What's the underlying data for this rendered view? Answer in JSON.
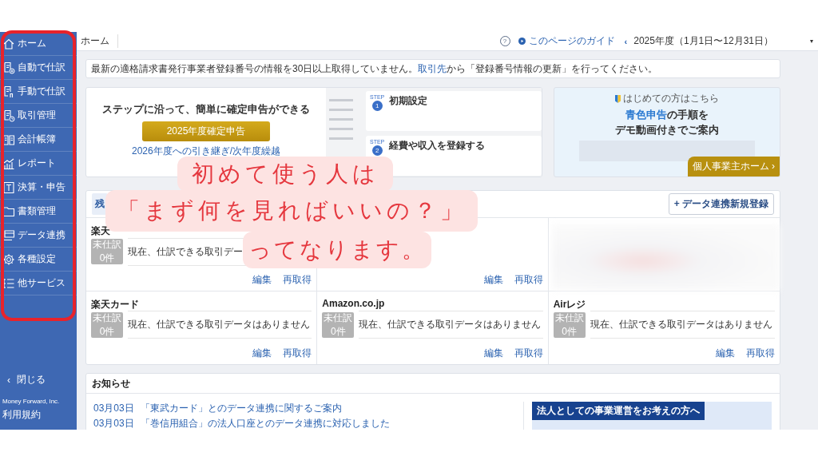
{
  "sidebar": {
    "items": [
      {
        "label": "ホーム"
      },
      {
        "label": "自動で仕訳"
      },
      {
        "label": "手動で仕訳"
      },
      {
        "label": "取引管理"
      },
      {
        "label": "会計帳簿"
      },
      {
        "label": "レポート"
      },
      {
        "label": "決算・申告"
      },
      {
        "label": "書類管理"
      },
      {
        "label": "データ連携"
      },
      {
        "label": "各種設定"
      },
      {
        "label": "他サービス"
      }
    ],
    "close": {
      "icon": "‹",
      "label": "閉じる"
    },
    "footer": [
      "Money Forward, Inc.",
      "利用規約"
    ]
  },
  "topbar": {
    "breadcrumb": "ホーム",
    "help": "?",
    "guide": "このページのガイド",
    "period_prev": "‹",
    "period": "2025年度（1月1日〜12月31日）",
    "dropdown": "▾"
  },
  "notice": {
    "before": "最新の適格請求書発行事業者登録番号の情報を30日以上取得していません。",
    "link": "取引先",
    "after": "から「登録番号情報の更新」を行ってください。"
  },
  "promo": {
    "heading": "ステップに沿って、簡単に確定申告ができる",
    "button": "2025年度確定申告",
    "link": "2026年度への引き継ぎ/次年度繰越",
    "steps": [
      {
        "label": "STEP",
        "number": "1",
        "title": "初期設定"
      },
      {
        "label": "STEP",
        "number": "2",
        "title": "経費や収入を登録する"
      }
    ]
  },
  "banner": {
    "eyebrow": "はじめての方はこちら",
    "headline": "**青色申告**の手順を",
    "subline": "デモ動画付きでご案内",
    "button": "個人事業主ホーム ›"
  },
  "accounts": {
    "tab": "残",
    "add_button": "+ データ連携新規登録",
    "cards": [
      {
        "title": "楽天",
        "badge": [
          "未仕訳",
          "0件"
        ],
        "message": "現在、仕訳できる取引デー",
        "actions": [
          "編集",
          "再取得"
        ],
        "blurred": false
      },
      {
        "actions": [
          "編集",
          "再取得"
        ],
        "blurred": false
      },
      {
        "blurred": true
      },
      {
        "title": "楽天カード",
        "badge": [
          "未仕訳",
          "0件"
        ],
        "message": "現在、仕訳できる取引データはありません",
        "actions": [
          "編集",
          "再取得"
        ],
        "blurred": false
      },
      {
        "title": "Amazon.co.jp",
        "badge": [
          "未仕訳",
          "0件"
        ],
        "message": "現在、仕訳できる取引データはありません",
        "actions": [
          "編集",
          "再取得"
        ],
        "blurred": false
      },
      {
        "title": "Airレジ",
        "badge": [
          "未仕訳",
          "0件"
        ],
        "message": "現在、仕訳できる取引データはありません",
        "actions": [
          "編集",
          "再取得"
        ],
        "blurred": false
      }
    ]
  },
  "news": {
    "title": "お知らせ",
    "items": [
      {
        "date": "03月03日",
        "text": "「東武カード」とのデータ連携に関するご案内"
      },
      {
        "date": "03月03日",
        "text": "「巻信用組合」の法人口座とのデータ連携に対応しました"
      }
    ],
    "promo": "法人としての事業運営をお考えの方へ"
  },
  "annotation": {
    "lines": [
      "初めて使う人は",
      "「まず何を見ればいいの？」",
      "ってなります。"
    ]
  }
}
